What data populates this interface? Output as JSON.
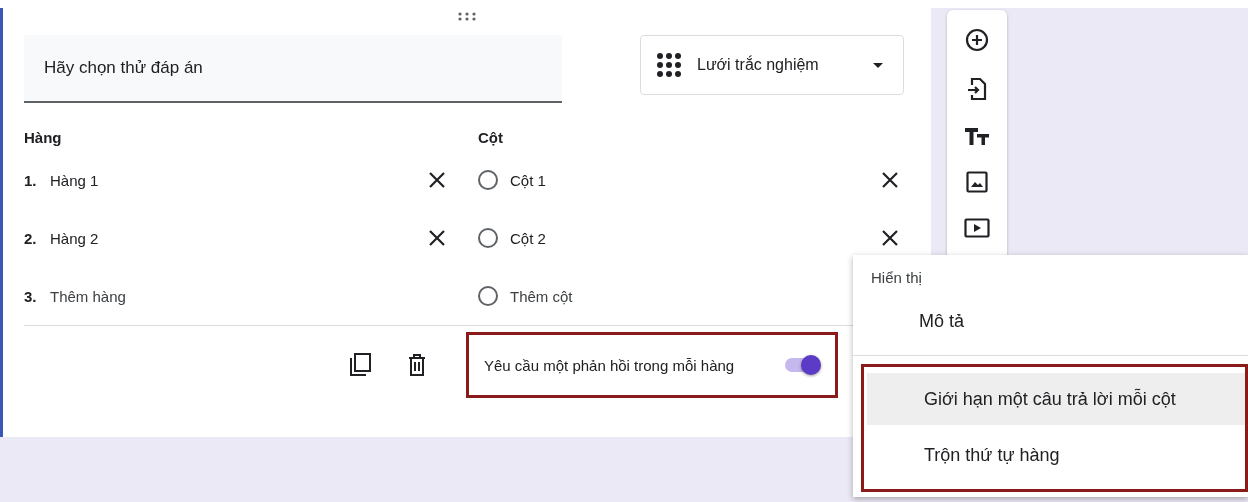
{
  "question": {
    "title": "Hãy chọn thử đáp án",
    "type_value": "Lưới trắc nghiệm"
  },
  "rows": {
    "heading": "Hàng",
    "items": [
      {
        "number": "1.",
        "label": "Hàng 1",
        "kind": "item"
      },
      {
        "number": "2.",
        "label": "Hàng 2",
        "kind": "item"
      },
      {
        "number": "3.",
        "label": "Thêm hàng",
        "kind": "add"
      }
    ]
  },
  "columns": {
    "heading": "Cột",
    "items": [
      {
        "label": "Cột 1",
        "kind": "item"
      },
      {
        "label": "Cột 2",
        "kind": "item"
      },
      {
        "label": "Thêm cột",
        "kind": "add"
      }
    ]
  },
  "required_toggle": {
    "label": "Yêu cầu một phản hồi trong mỗi hàng",
    "on": true,
    "highlighted": true
  },
  "menu": {
    "heading": "Hiển thị",
    "items": [
      {
        "label": "Mô tả",
        "selected": false,
        "highlighted": false
      },
      {
        "label": "Giới hạn một câu trả lời mỗi cột",
        "selected": true,
        "highlighted": true
      },
      {
        "label": "Trộn thứ tự hàng",
        "selected": false,
        "highlighted": true
      }
    ]
  }
}
